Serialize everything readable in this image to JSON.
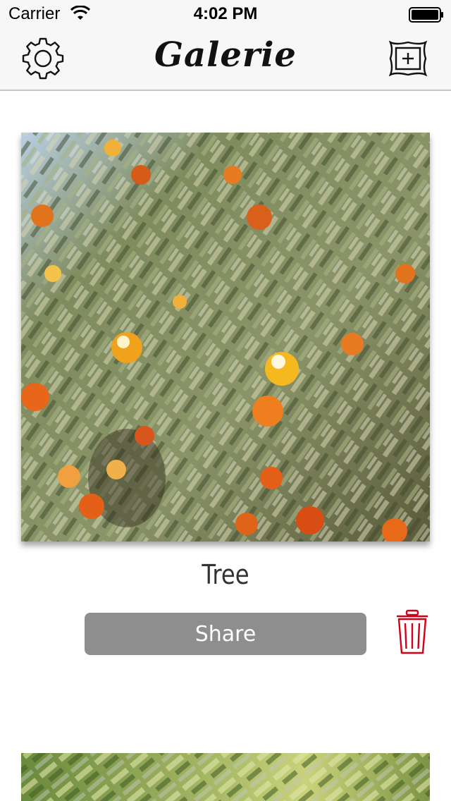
{
  "status_bar": {
    "carrier": "Carrier",
    "time": "4:02 PM",
    "wifi_icon": "wifi-icon",
    "battery_icon": "battery-icon"
  },
  "nav": {
    "title": "Galerie",
    "left_icon": "gear-icon",
    "right_icon": "add-frame-icon"
  },
  "gallery": {
    "items": [
      {
        "title": "Tree",
        "share_label": "Share",
        "delete_icon": "trash-icon"
      }
    ]
  },
  "colors": {
    "share_button": "#8e8e8e",
    "delete_icon": "#d0021b",
    "nav_background": "#f7f7f7"
  }
}
